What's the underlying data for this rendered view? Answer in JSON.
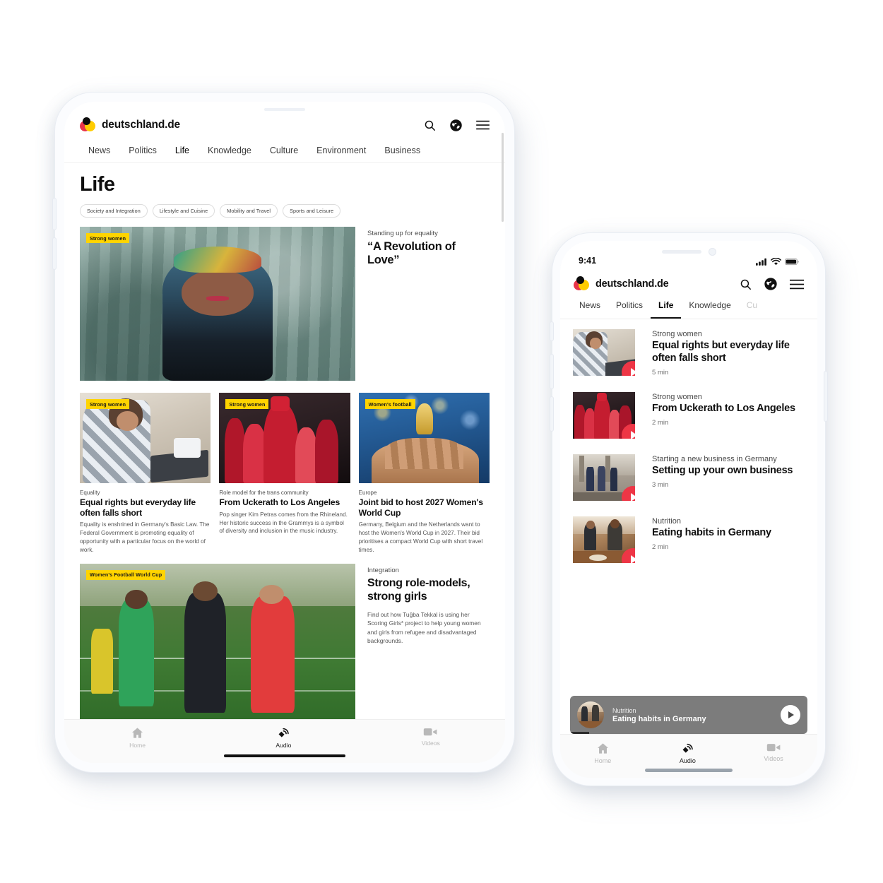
{
  "brand": {
    "name": "deutschland.de",
    "logo_colors": {
      "red": "#e8344a",
      "yellow": "#ffcc00",
      "black": "#0c0c0c"
    }
  },
  "accent_colors": {
    "badge_yellow": "#ffd400",
    "play_red": "#ee3646",
    "miniplayer_gray": "#7c7c7c"
  },
  "tablet": {
    "header": {
      "search_icon": "search-icon",
      "globe_icon": "globe-icon",
      "menu_icon": "hamburger-menu-icon"
    },
    "nav_tabs": [
      {
        "label": "News",
        "active": false
      },
      {
        "label": "Politics",
        "active": false
      },
      {
        "label": "Life",
        "active": true
      },
      {
        "label": "Knowledge",
        "active": false
      },
      {
        "label": "Culture",
        "active": false
      },
      {
        "label": "Environment",
        "active": false
      },
      {
        "label": "Business",
        "active": false
      }
    ],
    "page_title": "Life",
    "chips": [
      "Society and Integration",
      "Lifestyle and Cuisine",
      "Mobility and Travel",
      "Sports and Leisure"
    ],
    "hero": {
      "badge": "Strong women",
      "kicker": "Standing up for equality",
      "title": "“A Revolution of Love”"
    },
    "cards": [
      {
        "badge": "Strong women",
        "kicker": "Equality",
        "title": "Equal rights but everyday life often falls short",
        "body": "Equality is enshrined in Germany's Basic Law. The Federal Government is promoting equality of opportunity with a particular focus on the world of work."
      },
      {
        "badge": "Strong women",
        "kicker": "Role model for the trans community",
        "title": "From Uckerath to Los Angeles",
        "body": "Pop singer Kim Petras comes from the Rhineland. Her historic success in the Grammys is a symbol of diversity and inclusion in the music industry."
      },
      {
        "badge": "Women's football",
        "kicker": "Europe",
        "title": "Joint bid to host 2027 Women's World Cup",
        "body": "Germany, Belgium and the Netherlands want to host the Women's World Cup in 2027. Their bid prioritises a compact World Cup with short travel times."
      }
    ],
    "wide": {
      "badge": "Women's Football World Cup",
      "kicker": "Integration",
      "title": "Strong role-models, strong girls",
      "body": "Find out how Tuğba Tekkal is using her Scoring Girls* project to help young women and girls from refugee and disadvantaged backgrounds."
    },
    "tabbar": [
      {
        "label": "Home",
        "icon": "home-icon",
        "active": false
      },
      {
        "label": "Audio",
        "icon": "audio-icon",
        "active": true
      },
      {
        "label": "Videos",
        "icon": "video-camera-icon",
        "active": false
      }
    ]
  },
  "phone": {
    "status_bar": {
      "time": "9:41",
      "signal_icon": "cellular-signal-icon",
      "wifi_icon": "wifi-icon",
      "battery_icon": "battery-icon"
    },
    "header": {
      "search_icon": "search-icon",
      "globe_icon": "globe-icon",
      "menu_icon": "hamburger-menu-icon"
    },
    "nav_tabs": [
      {
        "label": "News",
        "active": false
      },
      {
        "label": "Politics",
        "active": false
      },
      {
        "label": "Life",
        "active": true
      },
      {
        "label": "Knowledge",
        "active": false
      },
      {
        "label": "Cu",
        "active": false
      }
    ],
    "audio_items": [
      {
        "kicker": "Strong women",
        "title": "Equal rights but everyday life often falls short",
        "duration": "5 min",
        "play_icon": "play-icon"
      },
      {
        "kicker": "Strong women",
        "title": "From Uckerath to Los Angeles",
        "duration": "2 min",
        "play_icon": "play-icon"
      },
      {
        "kicker": "Starting a new business in Germany",
        "title": "Setting up your own business",
        "duration": "3 min",
        "play_icon": "play-icon"
      },
      {
        "kicker": "Nutrition",
        "title": "Eating habits in Germany",
        "duration": "2 min",
        "play_icon": "play-icon"
      }
    ],
    "miniplayer": {
      "kicker": "Nutrition",
      "title": "Eating habits in Germany",
      "play_icon": "play-icon",
      "progress_percent": 8
    },
    "tabbar": [
      {
        "label": "Home",
        "icon": "home-icon",
        "active": false
      },
      {
        "label": "Audio",
        "icon": "audio-icon",
        "active": true
      },
      {
        "label": "Videos",
        "icon": "video-camera-icon",
        "active": false
      }
    ]
  }
}
